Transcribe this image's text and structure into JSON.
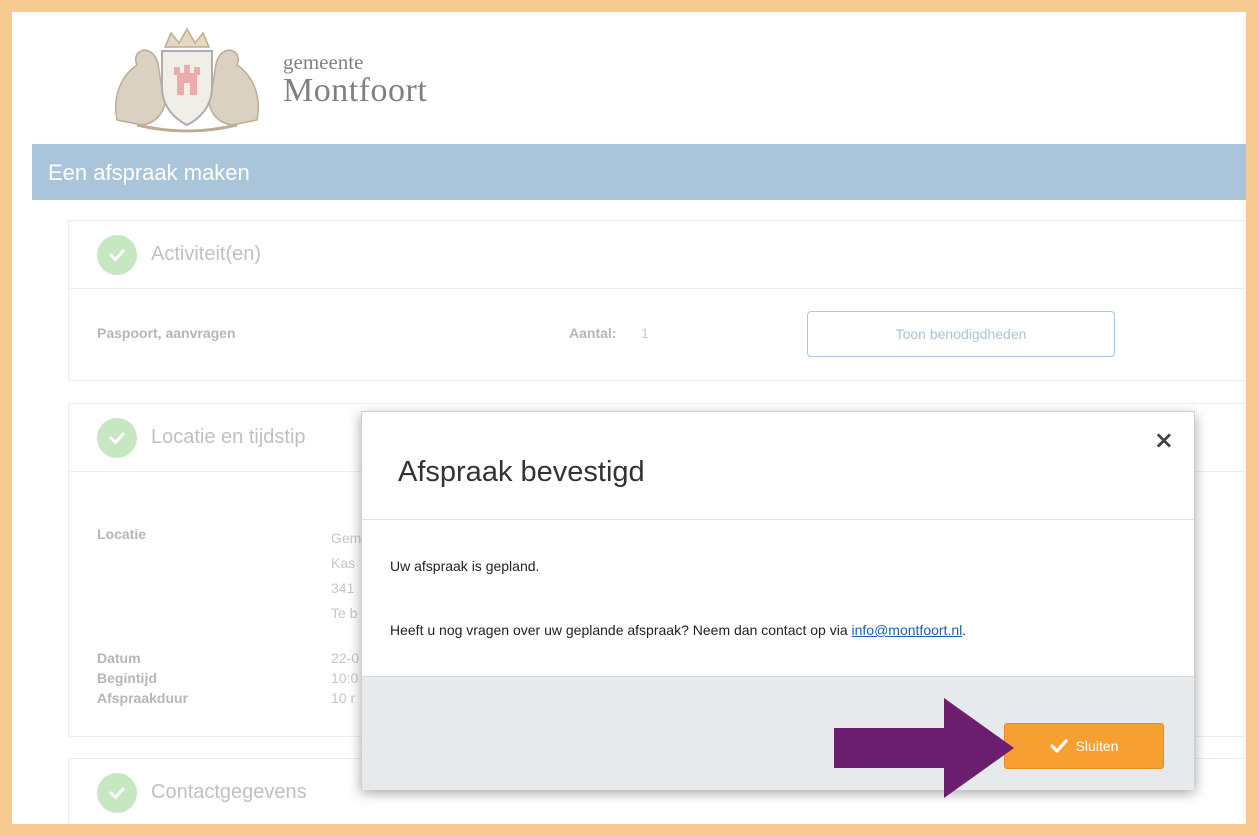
{
  "header": {
    "brand_small": "gemeente",
    "brand_big": "Montfoort",
    "page_title": "Een afspraak maken"
  },
  "activiteiten": {
    "title": "Activiteit(en)",
    "item_label": "Paspoort, aanvragen",
    "aantal_label": "Aantal:",
    "aantal_value": "1",
    "button_label": "Toon benodigdheden"
  },
  "locatie": {
    "title": "Locatie en tijdstip",
    "locatie_label": "Locatie",
    "locatie_lines": [
      "Gem",
      "Kas",
      "341",
      "Te b"
    ],
    "datum_label": "Datum",
    "datum_value": "22-0",
    "begintijd_label": "Begintijd",
    "begintijd_value": "10:0",
    "duur_label": "Afspraakduur",
    "duur_value": "10 r"
  },
  "contact": {
    "title": "Contactgegevens"
  },
  "modal": {
    "title": "Afspraak bevestigd",
    "close_symbol": "×",
    "text1": "Uw afspraak is gepland.",
    "text2_prefix": "Heeft u nog vragen over uw geplande afspraak? Neem dan contact op via ",
    "email": "info@montfoort.nl",
    "text2_suffix": ".",
    "button_label": "Sluiten"
  },
  "colors": {
    "accent_orange": "#f7a031",
    "title_bar": "#a6c1d8",
    "check_green": "#c4e6c0",
    "arrow_purple": "#6b1f6e",
    "frame": "#f5c98f"
  },
  "icons": [
    "crest-logo",
    "check-icon",
    "close-icon",
    "checkmark-icon",
    "arrow-annotation"
  ]
}
